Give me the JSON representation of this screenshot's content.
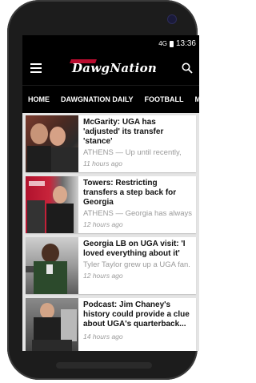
{
  "status_bar": {
    "signal": "4G",
    "time": "13:36"
  },
  "app": {
    "logo_text": "DawgNation"
  },
  "tabs": [
    "HOME",
    "DAWGNATION DAILY",
    "FOOTBALL",
    "MEN"
  ],
  "articles": [
    {
      "headline": "McGarity: UGA has 'adjusted' its transfer 'stance'",
      "excerpt": "ATHENS — Up until recently,",
      "time": "11 hours ago"
    },
    {
      "headline": "Towers: Restricting transfers a step back for Georgia",
      "excerpt": "ATHENS — Georgia has always",
      "time": "12 hours ago"
    },
    {
      "headline": "Georgia LB on UGA visit: 'I loved everything about it'",
      "excerpt": "Tyler Taylor grew up a UGA fan.",
      "time": "12 hours ago"
    },
    {
      "headline": "Podcast: Jim Chaney's history could provide a clue about UGA's quarterback...",
      "excerpt": "",
      "time": "14 hours ago"
    }
  ],
  "colors": {
    "brand_red": "#ba0c2f",
    "bar": "#000000",
    "feed_bg": "#e4e4e4"
  }
}
